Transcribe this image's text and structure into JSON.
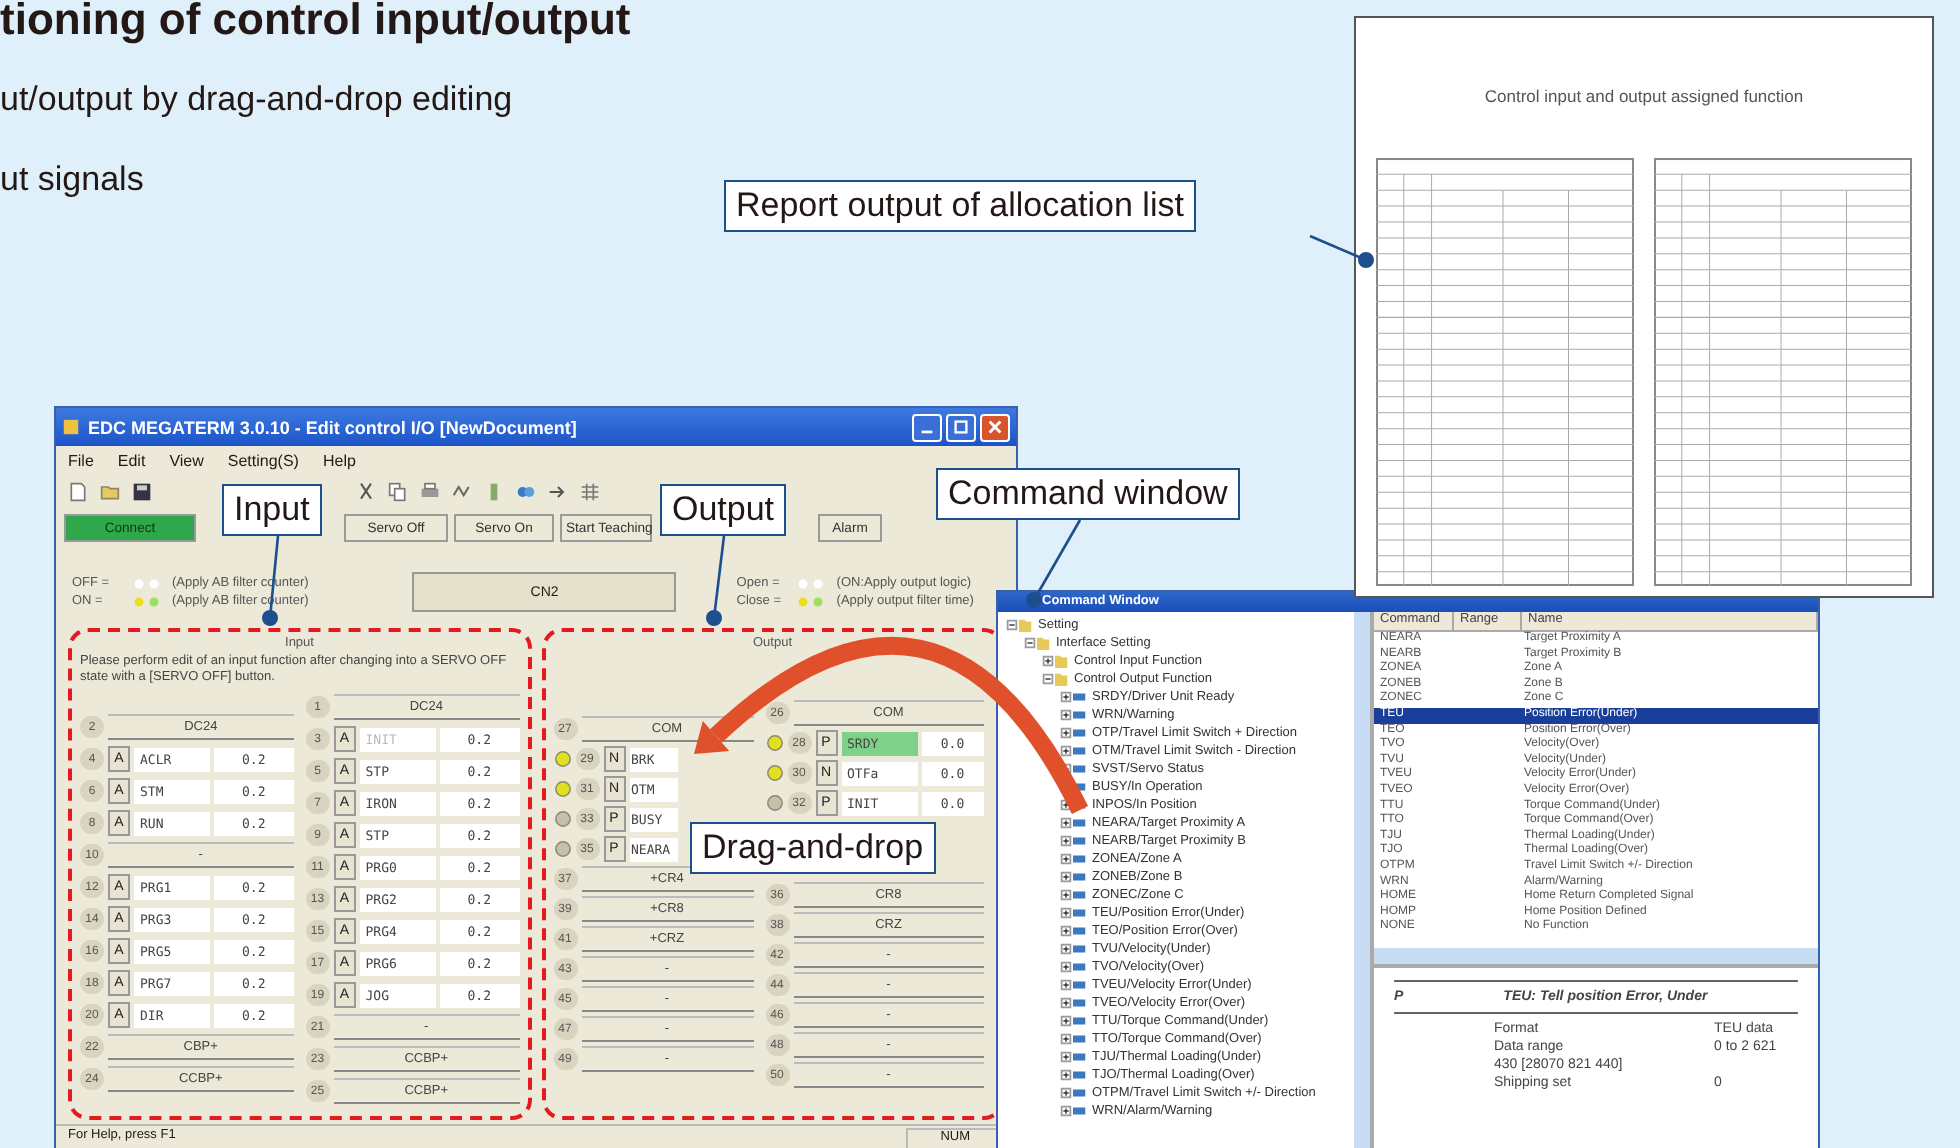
{
  "heading": {
    "title": "tioning of control input/output",
    "lines": [
      "ut/output by drag-and-drop editing",
      "ut signals"
    ]
  },
  "report": {
    "title": "Control input and output assigned function"
  },
  "callouts": [
    {
      "label": "Report output of allocation list"
    },
    {
      "label": "Input"
    },
    {
      "label": "Output"
    },
    {
      "label": "Command window"
    },
    {
      "label": "Drag-and-drop"
    }
  ],
  "main_window": {
    "title": "EDC MEGATERM 3.0.10 - Edit control I/O [NewDocument]",
    "menu": [
      "File",
      "Edit",
      "View",
      "Setting(S)",
      "Help"
    ],
    "buttons": [
      {
        "label": "Connect",
        "selected": true
      },
      {
        "label": "Servo Off",
        "selected": false
      },
      {
        "label": "Servo On",
        "selected": false
      },
      {
        "label": "Start Teaching",
        "selected": false
      },
      {
        "label": "Alarm",
        "selected": false
      }
    ],
    "legend": [
      {
        "state": "OFF =",
        "note": "(Apply AB filter counter)"
      },
      {
        "state": "ON =",
        "note": "(Apply AB filter counter)"
      }
    ],
    "connector": "CN2",
    "output_legend": [
      {
        "state": "Open =",
        "note": "(ON:Apply output logic)"
      },
      {
        "state": "Close =",
        "note": "(Apply output filter time)"
      }
    ],
    "input": {
      "title": "Input",
      "note": "Please perform edit of an input function after changing into a SERVO OFF state with a [SERVO OFF] button.",
      "columns": [
        [
          {
            "pin": "2",
            "kind": "fixed",
            "label": "DC24"
          },
          {
            "pin": "4",
            "kind": "signal",
            "polarity": "A",
            "name": "ACLR",
            "value": "0.2",
            "disabled": false
          },
          {
            "pin": "6",
            "kind": "signal",
            "polarity": "A",
            "name": "STM",
            "value": "0.2",
            "disabled": false
          },
          {
            "pin": "8",
            "kind": "signal",
            "polarity": "A",
            "name": "RUN",
            "value": "0.2",
            "disabled": false
          },
          {
            "pin": "10",
            "kind": "fixed",
            "label": "-"
          },
          {
            "pin": "12",
            "kind": "signal",
            "polarity": "A",
            "name": "PRG1",
            "value": "0.2",
            "disabled": false
          },
          {
            "pin": "14",
            "kind": "signal",
            "polarity": "A",
            "name": "PRG3",
            "value": "0.2",
            "disabled": false
          },
          {
            "pin": "16",
            "kind": "signal",
            "polarity": "A",
            "name": "PRG5",
            "value": "0.2",
            "disabled": false
          },
          {
            "pin": "18",
            "kind": "signal",
            "polarity": "A",
            "name": "PRG7",
            "value": "0.2",
            "disabled": false
          },
          {
            "pin": "20",
            "kind": "signal",
            "polarity": "A",
            "name": "DIR",
            "value": "0.2",
            "disabled": false
          },
          {
            "pin": "22",
            "kind": "fixed",
            "label": "CBP+"
          },
          {
            "pin": "24",
            "kind": "fixed",
            "label": "CCBP+"
          }
        ],
        [
          {
            "pin": "1",
            "kind": "fixed",
            "label": "DC24"
          },
          {
            "pin": "3",
            "kind": "signal",
            "polarity": "A",
            "name": "INIT",
            "value": "0.2",
            "disabled": true
          },
          {
            "pin": "5",
            "kind": "signal",
            "polarity": "A",
            "name": "STP",
            "value": "0.2",
            "disabled": false
          },
          {
            "pin": "7",
            "kind": "signal",
            "polarity": "A",
            "name": "IRON",
            "value": "0.2",
            "disabled": false
          },
          {
            "pin": "9",
            "kind": "signal",
            "polarity": "A",
            "name": "STP",
            "value": "0.2",
            "disabled": false
          },
          {
            "pin": "11",
            "kind": "signal",
            "polarity": "A",
            "name": "PRG0",
            "value": "0.2",
            "disabled": false
          },
          {
            "pin": "13",
            "kind": "signal",
            "polarity": "A",
            "name": "PRG2",
            "value": "0.2",
            "disabled": false
          },
          {
            "pin": "15",
            "kind": "signal",
            "polarity": "A",
            "name": "PRG4",
            "value": "0.2",
            "disabled": false
          },
          {
            "pin": "17",
            "kind": "signal",
            "polarity": "A",
            "name": "PRG6",
            "value": "0.2",
            "disabled": false
          },
          {
            "pin": "19",
            "kind": "signal",
            "polarity": "A",
            "name": "JOG",
            "value": "0.2",
            "disabled": false
          },
          {
            "pin": "21",
            "kind": "fixed",
            "label": "-"
          },
          {
            "pin": "23",
            "kind": "fixed",
            "label": "CCBP+"
          },
          {
            "pin": "25",
            "kind": "fixed",
            "label": "CCBP+"
          }
        ]
      ]
    },
    "output": {
      "title": "Output",
      "columns": [
        [
          {
            "pin": "27",
            "kind": "fixed",
            "label": "COM"
          },
          {
            "pin": "29",
            "kind": "signal",
            "polarity": "N",
            "name": "BRK",
            "active": true,
            "highlighted": false
          },
          {
            "pin": "31",
            "kind": "signal",
            "polarity": "N",
            "name": "OTM",
            "active": true,
            "highlighted": false
          },
          {
            "pin": "33",
            "kind": "signal",
            "polarity": "P",
            "name": "BUSY",
            "active": false,
            "highlighted": false
          },
          {
            "pin": "35",
            "kind": "signal",
            "polarity": "P",
            "name": "NEARA",
            "active": false,
            "highlighted": false
          },
          {
            "pin": "37",
            "kind": "fixed",
            "label": "+CR4"
          },
          {
            "pin": "39",
            "kind": "fixed",
            "label": "+CR8"
          },
          {
            "pin": "41",
            "kind": "fixed",
            "label": "+CRZ"
          },
          {
            "pin": "43",
            "kind": "fixed",
            "label": "-"
          },
          {
            "pin": "45",
            "kind": "fixed",
            "label": "-"
          },
          {
            "pin": "47",
            "kind": "fixed",
            "label": "-"
          },
          {
            "pin": "49",
            "kind": "fixed",
            "label": "-"
          }
        ],
        [
          {
            "pin": "26",
            "kind": "fixed",
            "label": "COM"
          },
          {
            "pin": "28",
            "kind": "signal",
            "polarity": "P",
            "name": "SRDY",
            "value": "0.0",
            "active": true,
            "highlighted": true
          },
          {
            "pin": "30",
            "kind": "signal",
            "polarity": "N",
            "name": "OTFa",
            "value": "0.0",
            "active": true,
            "highlighted": false
          },
          {
            "pin": "32",
            "kind": "signal",
            "polarity": "P",
            "name": "INIT",
            "value": "0.0",
            "active": false,
            "highlighted": false
          },
          {
            "kind": "covered"
          },
          {
            "pin": "36",
            "kind": "fixed",
            "label": "CR8"
          },
          {
            "pin": "38",
            "kind": "fixed",
            "label": "CRZ"
          },
          {
            "pin": "42",
            "kind": "fixed",
            "label": "-"
          },
          {
            "pin": "44",
            "kind": "fixed",
            "label": "-"
          },
          {
            "pin": "46",
            "kind": "fixed",
            "label": "-"
          },
          {
            "pin": "48",
            "kind": "fixed",
            "label": "-"
          },
          {
            "pin": "50",
            "kind": "fixed",
            "label": "-"
          }
        ]
      ]
    },
    "status_bar": [
      "For Help, press F1",
      "NUM"
    ]
  },
  "command_window": {
    "title": "Command Window",
    "tree": [
      {
        "label": "Setting",
        "expanded": true,
        "children": [
          {
            "label": "Interface Setting",
            "expanded": true,
            "children": [
              {
                "label": "Control Input Function",
                "expanded": false
              },
              {
                "label": "Control Output Function",
                "expanded": true,
                "children": [
                  {
                    "label": "SRDY/Driver Unit Ready"
                  },
                  {
                    "label": "WRN/Warning"
                  },
                  {
                    "label": "OTP/Travel Limit Switch + Direction"
                  },
                  {
                    "label": "OTM/Travel Limit Switch - Direction"
                  },
                  {
                    "label": "SVST/Servo Status"
                  },
                  {
                    "label": "BUSY/In Operation"
                  },
                  {
                    "label": "INPOS/In Position"
                  },
                  {
                    "label": "NEARA/Target Proximity A"
                  },
                  {
                    "label": "NEARB/Target Proximity B"
                  },
                  {
                    "label": "ZONEA/Zone A"
                  },
                  {
                    "label": "ZONEB/Zone B"
                  },
                  {
                    "label": "ZONEC/Zone C"
                  },
                  {
                    "label": "TEU/Position Error(Under)"
                  },
                  {
                    "label": "TEO/Position Error(Over)"
                  },
                  {
                    "label": "TVU/Velocity(Under)"
                  },
                  {
                    "label": "TVO/Velocity(Over)"
                  },
                  {
                    "label": "TVEU/Velocity Error(Under)"
                  },
                  {
                    "label": "TVEO/Velocity Error(Over)"
                  },
                  {
                    "label": "TTU/Torque Command(Under)"
                  },
                  {
                    "label": "TTO/Torque Command(Over)"
                  },
                  {
                    "label": "TJU/Thermal Loading(Under)"
                  },
                  {
                    "label": "TJO/Thermal Loading(Over)"
                  },
                  {
                    "label": "OTPM/Travel Limit Switch +/- Direction"
                  },
                  {
                    "label": "WRN/Alarm/Warning"
                  }
                ]
              }
            ]
          }
        ]
      }
    ],
    "columns": [
      "Command",
      "Range",
      "Name"
    ],
    "rows": [
      {
        "command": "NEARA",
        "name": "Target Proximity A",
        "selected": false
      },
      {
        "command": "NEARB",
        "name": "Target Proximity B",
        "selected": false
      },
      {
        "command": "ZONEA",
        "name": "Zone A",
        "selected": false
      },
      {
        "command": "ZONEB",
        "name": "Zone B",
        "selected": false
      },
      {
        "command": "ZONEC",
        "name": "Zone C",
        "selected": false
      },
      {
        "command": "TEU",
        "name": "Position Error(Under)",
        "selected": true
      },
      {
        "command": "TEO",
        "name": "Position Error(Over)",
        "selected": false
      },
      {
        "command": "TVO",
        "name": "Velocity(Over)",
        "selected": false
      },
      {
        "command": "TVU",
        "name": "Velocity(Under)",
        "selected": false
      },
      {
        "command": "TVEU",
        "name": "Velocity Error(Under)",
        "selected": false
      },
      {
        "command": "TVEO",
        "name": "Velocity Error(Over)",
        "selected": false
      },
      {
        "command": "TTU",
        "name": "Torque Command(Under)",
        "selected": false
      },
      {
        "command": "TTO",
        "name": "Torque Command(Over)",
        "selected": false
      },
      {
        "command": "TJU",
        "name": "Thermal Loading(Under)",
        "selected": false
      },
      {
        "command": "TJO",
        "name": "Thermal Loading(Over)",
        "selected": false
      },
      {
        "command": "OTPM",
        "name": "Travel Limit Switch +/- Direction",
        "selected": false
      },
      {
        "command": "WRN",
        "name": "Alarm/Warning",
        "selected": false
      },
      {
        "command": "HOME",
        "name": "Home Return Completed Signal",
        "selected": false
      },
      {
        "command": "HOMP",
        "name": "Home Position Defined",
        "selected": false
      },
      {
        "command": "NONE",
        "name": "No Function",
        "selected": false
      }
    ],
    "detail": {
      "mark": "P",
      "heading": "TEU: Tell position Error, Under",
      "fields": [
        {
          "label": "Format",
          "value": "TEU data"
        },
        {
          "label": "Data range",
          "value": "0 to 2 621"
        },
        {
          "label": "430 [28070 821 440]"
        },
        {
          "label": "Shipping set",
          "value": "0"
        }
      ]
    }
  }
}
